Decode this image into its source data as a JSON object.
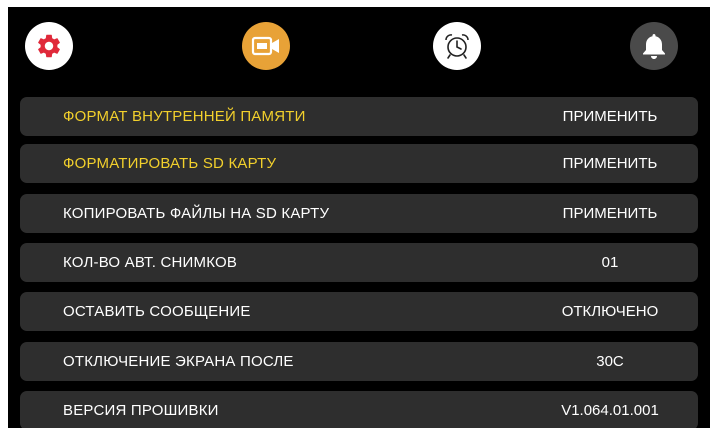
{
  "colors": {
    "screen_bg": "#000000",
    "row_bg": "#2e2e2e",
    "active_text": "#f2d02c",
    "text": "#ffffff",
    "settings_icon": "#e0293a",
    "video_tab": "#e8a237",
    "bell_tab": "#4a4a4a"
  },
  "tabs": [
    {
      "icon": "gear-icon",
      "selected": true
    },
    {
      "icon": "video-camera-icon",
      "selected": false
    },
    {
      "icon": "alarm-clock-icon",
      "selected": false
    },
    {
      "icon": "bell-icon",
      "selected": false
    }
  ],
  "menu": {
    "items": [
      {
        "label": "ФОРМАТ ВНУТРЕННЕЙ ПАМЯТИ",
        "value": "ПРИМЕНИТЬ",
        "highlighted": true
      },
      {
        "label": "ФОРМАТИРОВАТЬ SD КАРТУ",
        "value": "ПРИМЕНИТЬ",
        "highlighted": true
      },
      {
        "label": "КОПИРОВАТЬ ФАЙЛЫ НА SD КАРТУ",
        "value": "ПРИМЕНИТЬ",
        "highlighted": false
      },
      {
        "label": "КОЛ-ВО АВТ. СНИМКОВ",
        "value": "01",
        "highlighted": false
      },
      {
        "label": "ОСТАВИТЬ СООБЩЕНИЕ",
        "value": "ОТКЛЮЧЕНО",
        "highlighted": false
      },
      {
        "label": "ОТКЛЮЧЕНИЕ ЭКРАНА ПОСЛЕ",
        "value": "30С",
        "highlighted": false
      },
      {
        "label": "ВЕРСИЯ ПРОШИВКИ",
        "value": "V1.064.01.001",
        "highlighted": false
      }
    ]
  }
}
